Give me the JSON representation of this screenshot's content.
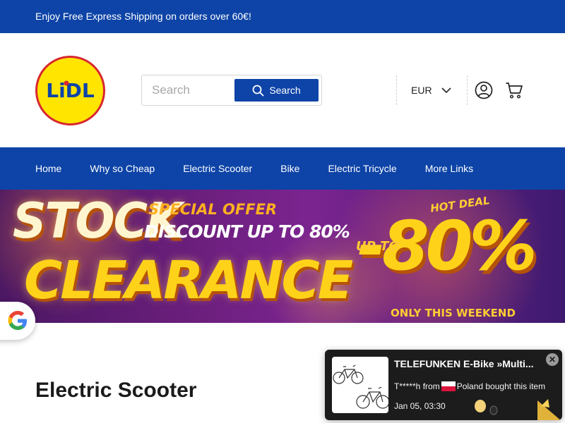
{
  "topbar": {
    "promo_text": "Enjoy Free Express Shipping on orders over 60€!"
  },
  "header": {
    "logo_text": "LiDL",
    "search": {
      "placeholder": "Search",
      "button_label": "Search"
    },
    "currency": "EUR",
    "icons": [
      "user-icon",
      "cart-icon",
      "search-icon",
      "chevron-down-icon"
    ]
  },
  "nav": {
    "items": [
      {
        "label": "Home"
      },
      {
        "label": "Why so Cheap"
      },
      {
        "label": "Electric Scooter"
      },
      {
        "label": "Bike"
      },
      {
        "label": "Electric Tricycle"
      },
      {
        "label": "More Links"
      }
    ]
  },
  "banner": {
    "stock": "STOCK",
    "special_offer": "SPECIAL OFFER",
    "discount": "DISCOUNT UP TO 80%",
    "clearance": "CLEARANCE",
    "hot_deal": "HOT DEAL",
    "up_to": "UP TO",
    "percent": "-80%",
    "weekend": "ONLY THIS WEEKEND",
    "colors": {
      "background": "#6c1f7d",
      "gold": "#ffd21a"
    }
  },
  "page": {
    "title": "Electric Scooter"
  },
  "toast": {
    "product": "TELEFUNKEN E-Bike »Multi...",
    "buyer": "T*****h from",
    "location": "Poland bought this item",
    "time": "Jan 05, 03:30",
    "close_icon": "close-icon"
  },
  "colors": {
    "brand_blue": "#0e44a7",
    "logo_yellow": "#ffe500",
    "logo_red": "#d8272f"
  }
}
